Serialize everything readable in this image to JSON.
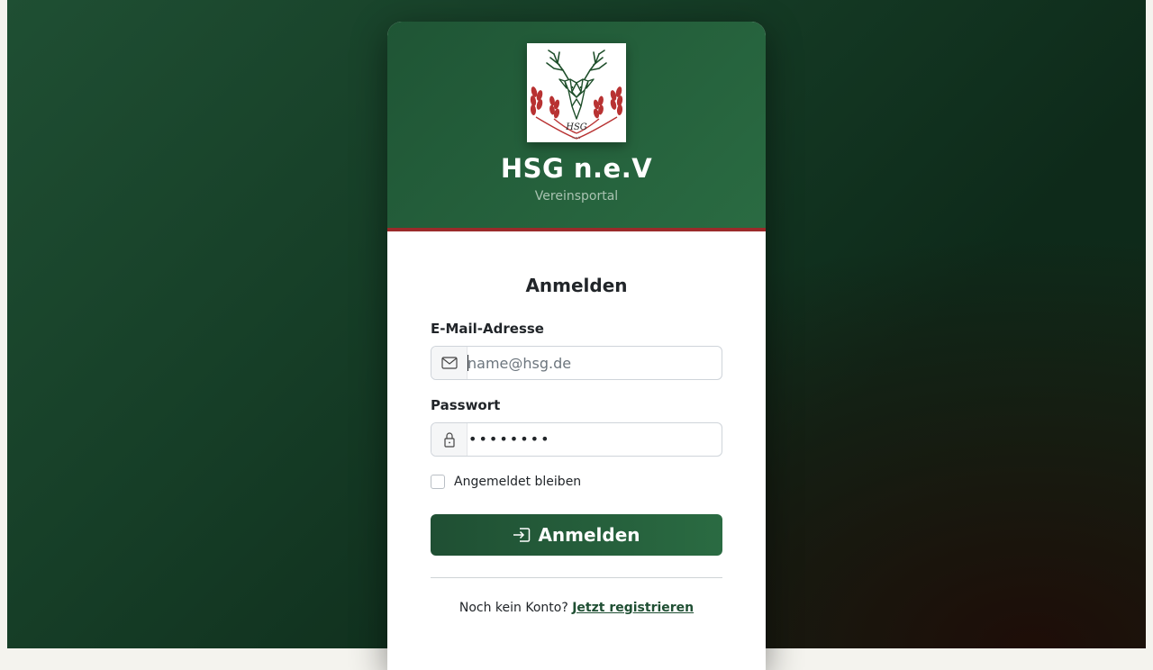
{
  "brand": {
    "title": "HSG n.e.V",
    "subtitle": "Vereinsportal",
    "logo_text": "HSG",
    "logo_small_text": "n.e.V"
  },
  "form": {
    "title": "Anmelden",
    "email": {
      "label": "E-Mail-Adresse",
      "placeholder": "name@hsg.de",
      "value": "",
      "icon": "envelope-icon"
    },
    "password": {
      "label": "Passwort",
      "masked_value": "••••••••",
      "icon": "lock-icon"
    },
    "remember": {
      "label": "Angemeldet bleiben",
      "checked": false
    },
    "submit_label": "Anmelden",
    "submit_icon": "sign-in-icon"
  },
  "footer": {
    "prompt": "Noch kein Konto?",
    "register_link": "Jetzt registrieren"
  },
  "colors": {
    "brand_green": "#1f5535",
    "accent_red": "#9b2a2a",
    "button_green": "#2a6b42"
  }
}
